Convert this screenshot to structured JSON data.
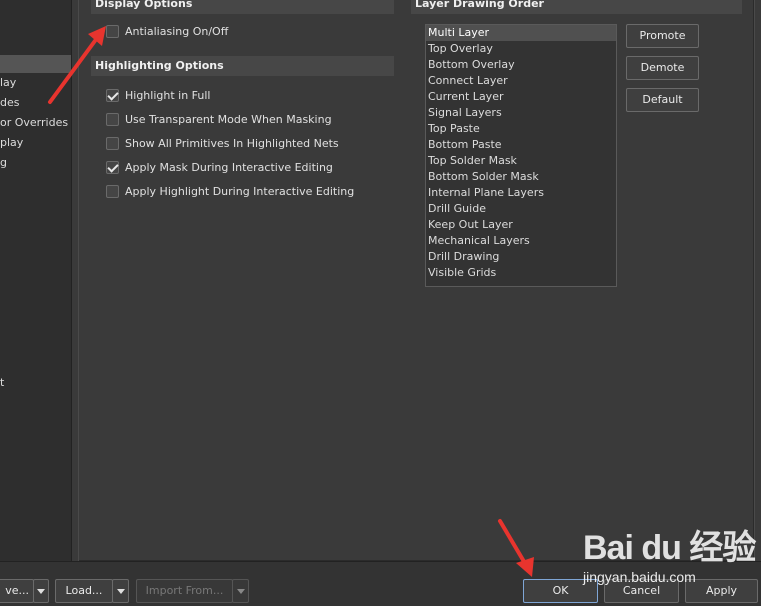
{
  "left_nav": {
    "items": [
      {
        "label": "",
        "selected": true
      },
      {
        "label": "lay",
        "selected": false
      },
      {
        "label": "des",
        "selected": false
      },
      {
        "label": "or Overrides",
        "selected": false
      },
      {
        "label": "play",
        "selected": false
      },
      {
        "label": "g",
        "selected": false
      },
      {
        "label": "t",
        "selected": false
      }
    ]
  },
  "display_options": {
    "title": "Display Options",
    "antialiasing": {
      "label": "Antialiasing On/Off",
      "checked": false
    }
  },
  "highlighting_options": {
    "title": "Highlighting Options",
    "items": [
      {
        "label": "Highlight in Full",
        "checked": true
      },
      {
        "label": "Use Transparent Mode When Masking",
        "checked": false
      },
      {
        "label": "Show All Primitives In Highlighted Nets",
        "checked": false
      },
      {
        "label": "Apply Mask During Interactive Editing",
        "checked": true
      },
      {
        "label": "Apply Highlight During Interactive Editing",
        "checked": false
      }
    ]
  },
  "layer_drawing_order": {
    "title": "Layer Drawing Order",
    "layers": [
      "Multi Layer",
      "Top Overlay",
      "Bottom Overlay",
      "Connect Layer",
      "Current Layer",
      "Signal Layers",
      "Top Paste",
      "Bottom Paste",
      "Top Solder Mask",
      "Bottom Solder Mask",
      "Internal Plane Layers",
      "Drill Guide",
      "Keep Out Layer",
      "Mechanical Layers",
      "Drill Drawing",
      "Visible Grids"
    ],
    "selected_layer": "Multi Layer",
    "promote_label": "Promote",
    "demote_label": "Demote",
    "default_label": "Default"
  },
  "bottom_bar": {
    "save_label": "ve...",
    "load_label": "Load...",
    "import_label": "Import From...",
    "ok_label": "OK",
    "cancel_label": "Cancel",
    "apply_label": "Apply"
  },
  "watermark": {
    "brand": "Bai du 经验",
    "url": "jingyan.baidu.com"
  },
  "colors": {
    "background": "#3a3a3a",
    "annotation_arrow": "#e8342e",
    "ok_focus_border": "#7fa6d6"
  }
}
